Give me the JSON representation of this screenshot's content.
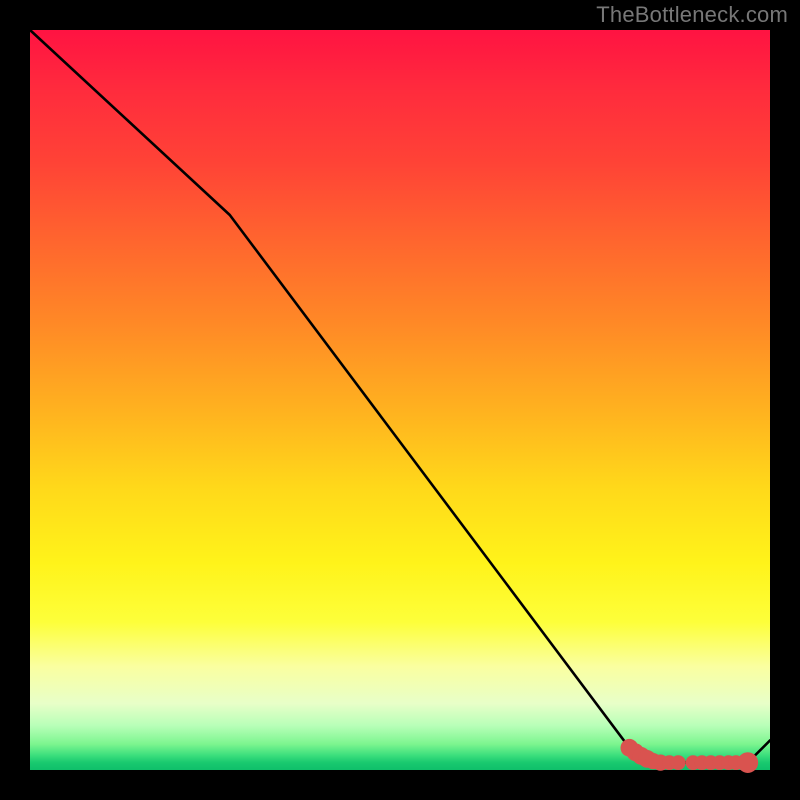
{
  "watermark": "TheBottleneck.com",
  "chart_data": {
    "type": "line",
    "title": "",
    "xlabel": "",
    "ylabel": "",
    "xlim": [
      0,
      100
    ],
    "ylim": [
      0,
      100
    ],
    "grid": false,
    "legend": false,
    "series": [
      {
        "name": "bottleneck-curve",
        "x": [
          0,
          27,
          81,
          85,
          92,
          97,
          100
        ],
        "y": [
          100,
          75,
          3,
          1,
          1,
          1,
          4
        ]
      }
    ],
    "markers": {
      "name": "highlight-points",
      "color": "#d9534f",
      "points": [
        {
          "x": 81.0,
          "y": 3.0,
          "r": 1.2
        },
        {
          "x": 81.8,
          "y": 2.4,
          "r": 1.2
        },
        {
          "x": 82.6,
          "y": 1.9,
          "r": 1.2
        },
        {
          "x": 83.4,
          "y": 1.5,
          "r": 1.2
        },
        {
          "x": 84.2,
          "y": 1.2,
          "r": 1.1
        },
        {
          "x": 85.2,
          "y": 1.0,
          "r": 1.1
        },
        {
          "x": 86.4,
          "y": 1.0,
          "r": 1.0
        },
        {
          "x": 87.6,
          "y": 1.0,
          "r": 1.0
        },
        {
          "x": 89.6,
          "y": 1.0,
          "r": 1.0
        },
        {
          "x": 90.8,
          "y": 1.0,
          "r": 1.0
        },
        {
          "x": 92.0,
          "y": 1.0,
          "r": 1.0
        },
        {
          "x": 93.2,
          "y": 1.0,
          "r": 1.0
        },
        {
          "x": 94.4,
          "y": 1.0,
          "r": 1.0
        },
        {
          "x": 95.4,
          "y": 1.0,
          "r": 1.0
        },
        {
          "x": 97.0,
          "y": 1.0,
          "r": 1.4
        }
      ]
    },
    "background_gradient": {
      "top": "#ff1342",
      "mid": "#ffd91a",
      "bottom": "#0fbf6a"
    }
  }
}
